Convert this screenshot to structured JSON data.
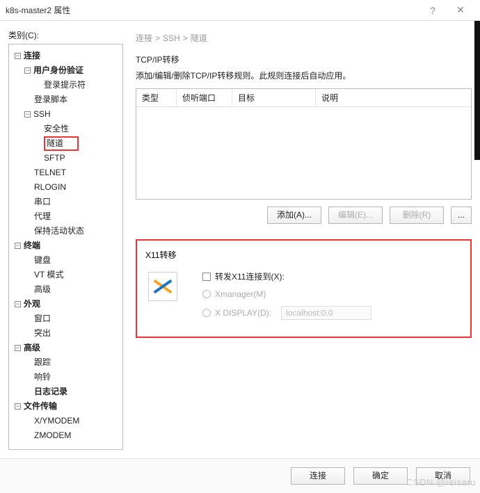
{
  "window": {
    "title": "k8s-master2 属性",
    "help": "?",
    "close": "✕"
  },
  "leftLabel": "类别(C):",
  "tree": {
    "n0": "连接",
    "n0_0": "用户身份验证",
    "n0_0_0": "登录提示符",
    "n0_1": "登录脚本",
    "n0_2": "SSH",
    "n0_2_0": "安全性",
    "n0_2_1": "隧道",
    "n0_2_2": "SFTP",
    "n0_3": "TELNET",
    "n0_4": "RLOGIN",
    "n0_5": "串口",
    "n0_6": "代理",
    "n0_7": "保持活动状态",
    "n1": "终端",
    "n1_0": "键盘",
    "n1_1": "VT 模式",
    "n1_2": "高级",
    "n2": "外观",
    "n2_0": "窗口",
    "n2_1": "突出",
    "n3": "高级",
    "n3_0": "跟踪",
    "n3_1": "响铃",
    "n3_2": "日志记录",
    "n4": "文件传输",
    "n4_0": "X/YMODEM",
    "n4_1": "ZMODEM"
  },
  "bc": {
    "a": "连接",
    "b": "SSH",
    "c": "隧道"
  },
  "tcp": {
    "title": "TCP/IP转移",
    "desc": "添加/编辑/删除TCP/IP转移规则。此规则连接后自动应用。",
    "col1": "类型",
    "col2": "侦听端口",
    "col3": "目标",
    "col4": "说明"
  },
  "btns": {
    "add": "添加(A)...",
    "edit": "编辑(E)...",
    "del": "删除(R)",
    "more": "..."
  },
  "x11": {
    "title": "X11转移",
    "forward": "转发X11连接到(X):",
    "xmgr": "Xmanager(M)",
    "xdisp": "X DISPLAY(D):",
    "xdisp_val": "localhost:0.0"
  },
  "footer": {
    "connect": "连接",
    "ok": "确定",
    "cancel": "取消"
  },
  "wm": "CSDN @reisaru"
}
